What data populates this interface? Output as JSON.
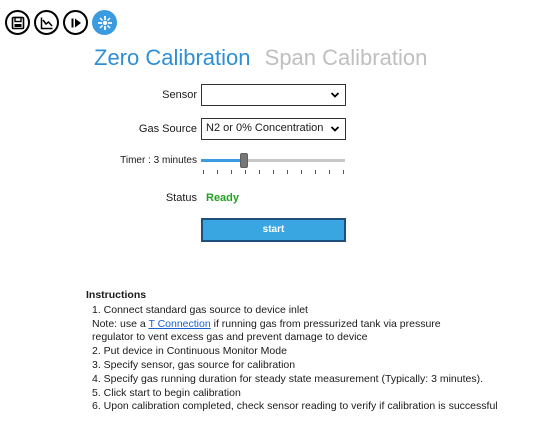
{
  "toolbar": {
    "buttons": [
      {
        "icon": "save-icon"
      },
      {
        "icon": "chart-icon"
      },
      {
        "icon": "play-icon"
      },
      {
        "icon": "calibration-icon",
        "active": true
      }
    ]
  },
  "tabs": {
    "zero_label": "Zero Calibration",
    "span_label": "Span Calibration",
    "active": "zero"
  },
  "form": {
    "sensor_label": "Sensor",
    "sensor_value": "",
    "gas_source_label": "Gas Source",
    "gas_source_value": "N2 or 0% Concentration",
    "timer_label": "Timer : 3 minutes",
    "timer_level_fraction": 0.3,
    "status_label": "Status",
    "status_value": "Ready",
    "start_label": "start"
  },
  "instructions": {
    "title": "Instructions",
    "step1": "1. Connect standard gas source to device inlet",
    "note_prefix": "Note: use a ",
    "note_link": "T Connection",
    "note_suffix": " if running gas from pressurized tank via pressure",
    "note_line2": "regulator to vent excess gas and prevent damage to device",
    "step2": "2. Put device in Continuous Monitor Mode",
    "step3": "3. Specify sensor, gas source for calibration",
    "step4": "4. Specify gas running duration for steady state measurement (Typically: 3 minutes).",
    "step5": "5. Click start to begin calibration",
    "step6": "6. Upon calibration completed, check sensor reading to verify if calibration is successful"
  },
  "colors": {
    "accent": "#2e8fd6",
    "button": "#39a6e2",
    "status_ready": "#21a021",
    "link": "#1a5fd0"
  }
}
